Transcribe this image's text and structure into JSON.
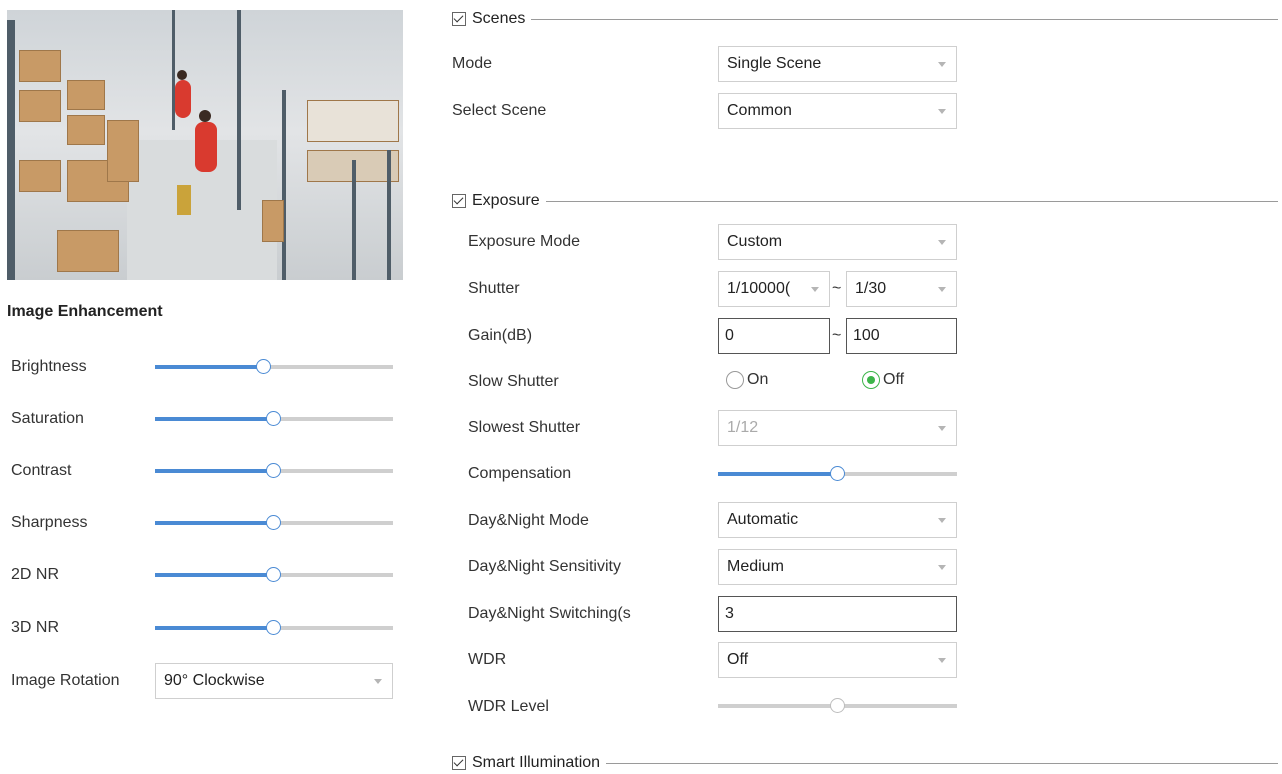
{
  "image_enhancement": {
    "title": "Image Enhancement",
    "sliders": [
      {
        "label": "Brightness",
        "value": 0.46
      },
      {
        "label": "Saturation",
        "value": 0.5
      },
      {
        "label": "Contrast",
        "value": 0.5
      },
      {
        "label": "Sharpness",
        "value": 0.5
      },
      {
        "label": "2D NR",
        "value": 0.5
      },
      {
        "label": "3D NR",
        "value": 0.5
      }
    ],
    "rotation_label": "Image Rotation",
    "rotation_value": "90° Clockwise"
  },
  "scenes": {
    "title": "Scenes",
    "mode_label": "Mode",
    "mode_value": "Single Scene",
    "select_scene_label": "Select Scene",
    "select_scene_value": "Common"
  },
  "exposure": {
    "title": "Exposure",
    "exposure_mode_label": "Exposure Mode",
    "exposure_mode_value": "Custom",
    "shutter_label": "Shutter",
    "shutter_min": "1/10000(",
    "shutter_max": "1/30",
    "range_separator": "~",
    "gain_label": "Gain(dB)",
    "gain_min": "0",
    "gain_max": "100",
    "slow_shutter_label": "Slow Shutter",
    "slow_shutter_on": "On",
    "slow_shutter_off": "Off",
    "slowest_shutter_label": "Slowest Shutter",
    "slowest_shutter_value": "1/12",
    "compensation_label": "Compensation",
    "compensation_value": 0.5,
    "day_night_mode_label": "Day&Night Mode",
    "day_night_mode_value": "Automatic",
    "day_night_sensitivity_label": "Day&Night Sensitivity",
    "day_night_sensitivity_value": "Medium",
    "day_night_switching_label": "Day&Night Switching(s",
    "day_night_switching_value": "3",
    "wdr_label": "WDR",
    "wdr_value": "Off",
    "wdr_level_label": "WDR Level",
    "wdr_level_value": 0.5
  },
  "smart_illumination": {
    "title": "Smart Illumination"
  },
  "colors": {
    "accent": "#4a8ad4",
    "radio_on": "#3cb54a"
  }
}
